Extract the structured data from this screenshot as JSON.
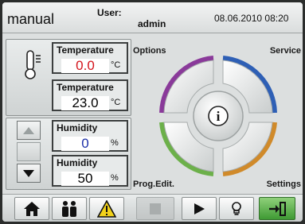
{
  "header": {
    "mode": "manual",
    "user_label": "User:",
    "user_name": "admin",
    "datetime": "08.06.2010 08:20"
  },
  "temperature_actual": {
    "label": "Temperature",
    "value": "0.0",
    "unit": "°C",
    "color": "#d4141c"
  },
  "temperature_setpoint": {
    "label": "Temperature",
    "value": "23.0",
    "unit": "°C"
  },
  "humidity_actual": {
    "label": "Humidity",
    "value": "0",
    "unit": "%",
    "color": "#1c2fa8"
  },
  "humidity_setpoint": {
    "label": "Humidity",
    "value": "50",
    "unit": "%"
  },
  "menu": {
    "options": "Options",
    "service": "Service",
    "prog_edit": "Prog.Edit.",
    "settings": "Settings",
    "info_symbol": "i"
  },
  "wheel_colors": {
    "options_quadrant": "#8a3a9a",
    "service_quadrant": "#2e5fb5",
    "prog_edit_quadrant": "#6cb04a",
    "settings_quadrant": "#d08a2a"
  },
  "toolbar": {
    "items": [
      {
        "name": "home-icon"
      },
      {
        "name": "users-icon"
      },
      {
        "name": "warning-icon"
      },
      {
        "name": "stop-icon",
        "state": "disabled"
      },
      {
        "name": "play-icon"
      },
      {
        "name": "lightbulb-icon"
      },
      {
        "name": "logout-icon"
      }
    ]
  }
}
